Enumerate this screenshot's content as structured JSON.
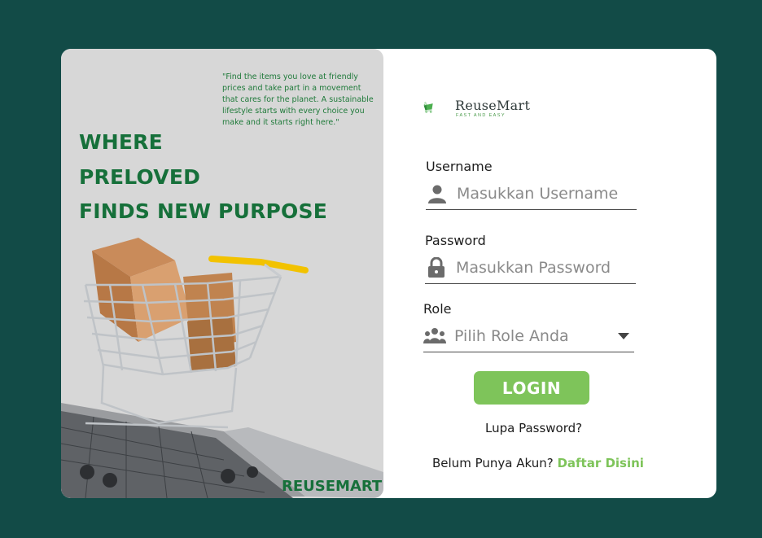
{
  "hero": {
    "quote": "\"Find the items you love at friendly prices and take part in a movement that cares for the planet. A sustainable lifestyle starts with every choice you make and it starts right here.\"",
    "headline": [
      "WHERE",
      "PRELOVED",
      "FINDS NEW PURPOSE"
    ],
    "footer_brand": "REUSEMART"
  },
  "logo": {
    "name": "ReuseMart",
    "tagline": "FAST AND EASY"
  },
  "form": {
    "username": {
      "label": "Username",
      "placeholder": "Masukkan Username",
      "icon": "user-icon"
    },
    "password": {
      "label": "Password",
      "placeholder": "Masukkan Password",
      "icon": "lock-icon"
    },
    "role": {
      "label": "Role",
      "selected": "Pilih Role Anda",
      "icon": "group-icon"
    },
    "login_label": "LOGIN",
    "forgot_label": "Lupa Password?",
    "signup_prompt": "Belum Punya Akun?",
    "signup_link": "Daftar Disini"
  },
  "colors": {
    "background": "#124b47",
    "brand_green": "#16703a",
    "accent_green": "#7ec45a"
  }
}
